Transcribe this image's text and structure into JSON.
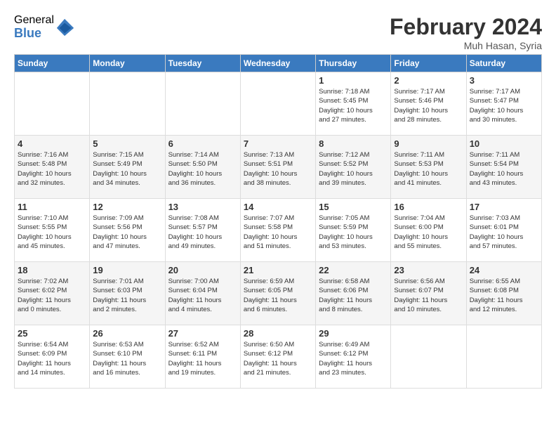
{
  "header": {
    "logo_general": "General",
    "logo_blue": "Blue",
    "month_year": "February 2024",
    "location": "Muh Hasan, Syria"
  },
  "days_of_week": [
    "Sunday",
    "Monday",
    "Tuesday",
    "Wednesday",
    "Thursday",
    "Friday",
    "Saturday"
  ],
  "weeks": [
    [
      {
        "num": "",
        "info": ""
      },
      {
        "num": "",
        "info": ""
      },
      {
        "num": "",
        "info": ""
      },
      {
        "num": "",
        "info": ""
      },
      {
        "num": "1",
        "info": "Sunrise: 7:18 AM\nSunset: 5:45 PM\nDaylight: 10 hours\nand 27 minutes."
      },
      {
        "num": "2",
        "info": "Sunrise: 7:17 AM\nSunset: 5:46 PM\nDaylight: 10 hours\nand 28 minutes."
      },
      {
        "num": "3",
        "info": "Sunrise: 7:17 AM\nSunset: 5:47 PM\nDaylight: 10 hours\nand 30 minutes."
      }
    ],
    [
      {
        "num": "4",
        "info": "Sunrise: 7:16 AM\nSunset: 5:48 PM\nDaylight: 10 hours\nand 32 minutes."
      },
      {
        "num": "5",
        "info": "Sunrise: 7:15 AM\nSunset: 5:49 PM\nDaylight: 10 hours\nand 34 minutes."
      },
      {
        "num": "6",
        "info": "Sunrise: 7:14 AM\nSunset: 5:50 PM\nDaylight: 10 hours\nand 36 minutes."
      },
      {
        "num": "7",
        "info": "Sunrise: 7:13 AM\nSunset: 5:51 PM\nDaylight: 10 hours\nand 38 minutes."
      },
      {
        "num": "8",
        "info": "Sunrise: 7:12 AM\nSunset: 5:52 PM\nDaylight: 10 hours\nand 39 minutes."
      },
      {
        "num": "9",
        "info": "Sunrise: 7:11 AM\nSunset: 5:53 PM\nDaylight: 10 hours\nand 41 minutes."
      },
      {
        "num": "10",
        "info": "Sunrise: 7:11 AM\nSunset: 5:54 PM\nDaylight: 10 hours\nand 43 minutes."
      }
    ],
    [
      {
        "num": "11",
        "info": "Sunrise: 7:10 AM\nSunset: 5:55 PM\nDaylight: 10 hours\nand 45 minutes."
      },
      {
        "num": "12",
        "info": "Sunrise: 7:09 AM\nSunset: 5:56 PM\nDaylight: 10 hours\nand 47 minutes."
      },
      {
        "num": "13",
        "info": "Sunrise: 7:08 AM\nSunset: 5:57 PM\nDaylight: 10 hours\nand 49 minutes."
      },
      {
        "num": "14",
        "info": "Sunrise: 7:07 AM\nSunset: 5:58 PM\nDaylight: 10 hours\nand 51 minutes."
      },
      {
        "num": "15",
        "info": "Sunrise: 7:05 AM\nSunset: 5:59 PM\nDaylight: 10 hours\nand 53 minutes."
      },
      {
        "num": "16",
        "info": "Sunrise: 7:04 AM\nSunset: 6:00 PM\nDaylight: 10 hours\nand 55 minutes."
      },
      {
        "num": "17",
        "info": "Sunrise: 7:03 AM\nSunset: 6:01 PM\nDaylight: 10 hours\nand 57 minutes."
      }
    ],
    [
      {
        "num": "18",
        "info": "Sunrise: 7:02 AM\nSunset: 6:02 PM\nDaylight: 11 hours\nand 0 minutes."
      },
      {
        "num": "19",
        "info": "Sunrise: 7:01 AM\nSunset: 6:03 PM\nDaylight: 11 hours\nand 2 minutes."
      },
      {
        "num": "20",
        "info": "Sunrise: 7:00 AM\nSunset: 6:04 PM\nDaylight: 11 hours\nand 4 minutes."
      },
      {
        "num": "21",
        "info": "Sunrise: 6:59 AM\nSunset: 6:05 PM\nDaylight: 11 hours\nand 6 minutes."
      },
      {
        "num": "22",
        "info": "Sunrise: 6:58 AM\nSunset: 6:06 PM\nDaylight: 11 hours\nand 8 minutes."
      },
      {
        "num": "23",
        "info": "Sunrise: 6:56 AM\nSunset: 6:07 PM\nDaylight: 11 hours\nand 10 minutes."
      },
      {
        "num": "24",
        "info": "Sunrise: 6:55 AM\nSunset: 6:08 PM\nDaylight: 11 hours\nand 12 minutes."
      }
    ],
    [
      {
        "num": "25",
        "info": "Sunrise: 6:54 AM\nSunset: 6:09 PM\nDaylight: 11 hours\nand 14 minutes."
      },
      {
        "num": "26",
        "info": "Sunrise: 6:53 AM\nSunset: 6:10 PM\nDaylight: 11 hours\nand 16 minutes."
      },
      {
        "num": "27",
        "info": "Sunrise: 6:52 AM\nSunset: 6:11 PM\nDaylight: 11 hours\nand 19 minutes."
      },
      {
        "num": "28",
        "info": "Sunrise: 6:50 AM\nSunset: 6:12 PM\nDaylight: 11 hours\nand 21 minutes."
      },
      {
        "num": "29",
        "info": "Sunrise: 6:49 AM\nSunset: 6:12 PM\nDaylight: 11 hours\nand 23 minutes."
      },
      {
        "num": "",
        "info": ""
      },
      {
        "num": "",
        "info": ""
      }
    ]
  ]
}
